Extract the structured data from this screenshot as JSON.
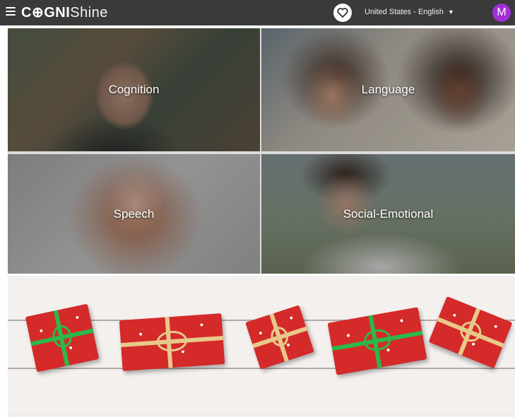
{
  "header": {
    "brand_bold": "C⊕GNI",
    "brand_light": "Shine",
    "locale": "United States - English",
    "avatar_initial": "M"
  },
  "tiles": [
    {
      "label": "Cognition"
    },
    {
      "label": "Language"
    },
    {
      "label": "Speech"
    },
    {
      "label": "Social-Emotional"
    }
  ],
  "banner": {
    "description_icons": [
      "gift-icon"
    ],
    "ribbon_colors": [
      "#2db84a",
      "#e8c98a",
      "#e8c98a",
      "#2db84a",
      "#e8c98a"
    ]
  },
  "colors": {
    "topbar": "#3a3a3a",
    "avatar": "#a12fd6",
    "gift_red": "#d42a2a"
  }
}
